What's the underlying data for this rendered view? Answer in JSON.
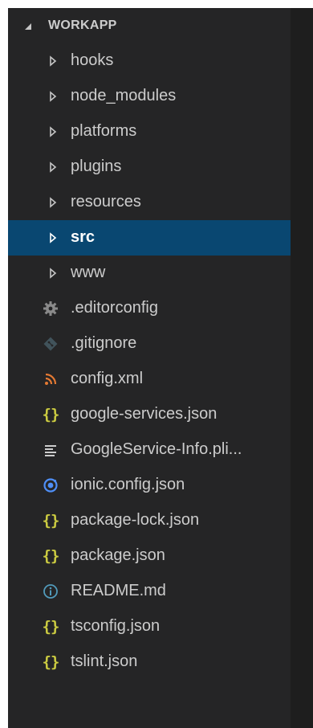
{
  "explorer": {
    "root_label": "WORKAPP",
    "folders": [
      {
        "label": "hooks",
        "selected": false
      },
      {
        "label": "node_modules",
        "selected": false
      },
      {
        "label": "platforms",
        "selected": false
      },
      {
        "label": "plugins",
        "selected": false
      },
      {
        "label": "resources",
        "selected": false
      },
      {
        "label": "src",
        "selected": true
      },
      {
        "label": "www",
        "selected": false
      }
    ],
    "files": [
      {
        "label": ".editorconfig",
        "icon": "gear-icon"
      },
      {
        "label": ".gitignore",
        "icon": "git-icon"
      },
      {
        "label": "config.xml",
        "icon": "rss-icon"
      },
      {
        "label": "google-services.json",
        "icon": "json-braces-icon"
      },
      {
        "label": "GoogleService-Info.pli...",
        "icon": "lines-icon"
      },
      {
        "label": "ionic.config.json",
        "icon": "ionic-icon"
      },
      {
        "label": "package-lock.json",
        "icon": "json-braces-icon"
      },
      {
        "label": "package.json",
        "icon": "json-braces-icon"
      },
      {
        "label": "README.md",
        "icon": "info-icon"
      },
      {
        "label": "tsconfig.json",
        "icon": "json-braces-icon"
      },
      {
        "label": "tslint.json",
        "icon": "json-braces-icon"
      }
    ]
  },
  "colors": {
    "sidebar_bg": "#252526",
    "editor_bg": "#1e1e1e",
    "selection_bg": "#094771",
    "text": "#cccccc",
    "json_yellow": "#cbcb41",
    "ionic_blue": "#4f8ff7",
    "info_blue": "#519aba",
    "rss_orange": "#e37933"
  }
}
